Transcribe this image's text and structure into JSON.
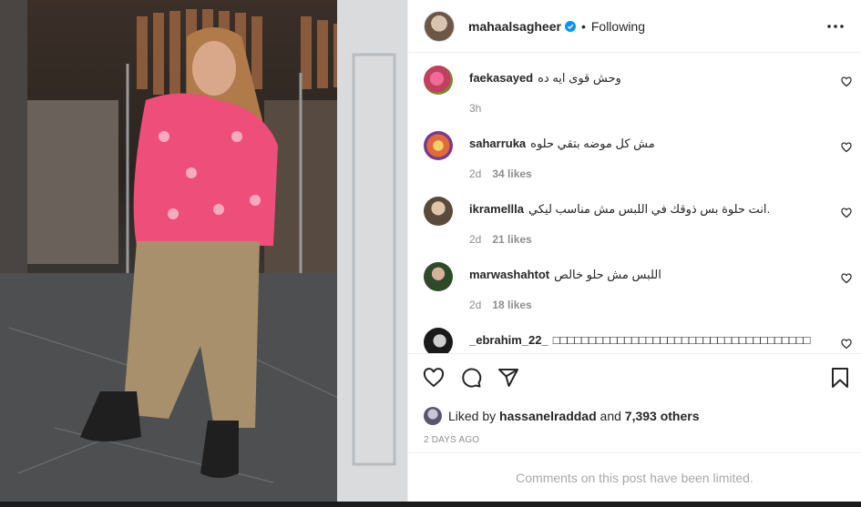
{
  "post": {
    "author": "mahaalsagheer",
    "separator": "•",
    "follow_state": "Following",
    "photo_alt": "Woman in pink jacket and beige harem pants standing in a shop"
  },
  "comments": [
    {
      "user": "faekasayed",
      "text": "وحش قوى ايه ده",
      "age": "3h",
      "likes": ""
    },
    {
      "user": "saharruka",
      "text": "مش كل موضه بتقي حلوه",
      "age": "2d",
      "likes": "34 likes"
    },
    {
      "user": "ikramellla",
      "text": "انت حلوة بس ذوقك في اللبس مش مناسب ليكي.",
      "age": "2d",
      "likes": "21 likes"
    },
    {
      "user": "marwashahtot",
      "text": "اللبس مش حلو خالص",
      "age": "2d",
      "likes": "18 likes"
    },
    {
      "user": "_ebrahim_22_",
      "text": "□□□□□□□□□□□□□□□□□□□□□□□□□□□□□□□□□□□□",
      "age": "",
      "likes": ""
    }
  ],
  "likes": {
    "prefix": "Liked by",
    "user": "hassanelraddad",
    "conj": "and",
    "others": "7,393 others"
  },
  "date_label": "2 DAYS AGO",
  "comments_limited": "Comments on this post have been limited.",
  "colors": {
    "verified": "#0095f6",
    "muted": "#8e8e8e",
    "jacket": "#f0507a"
  }
}
